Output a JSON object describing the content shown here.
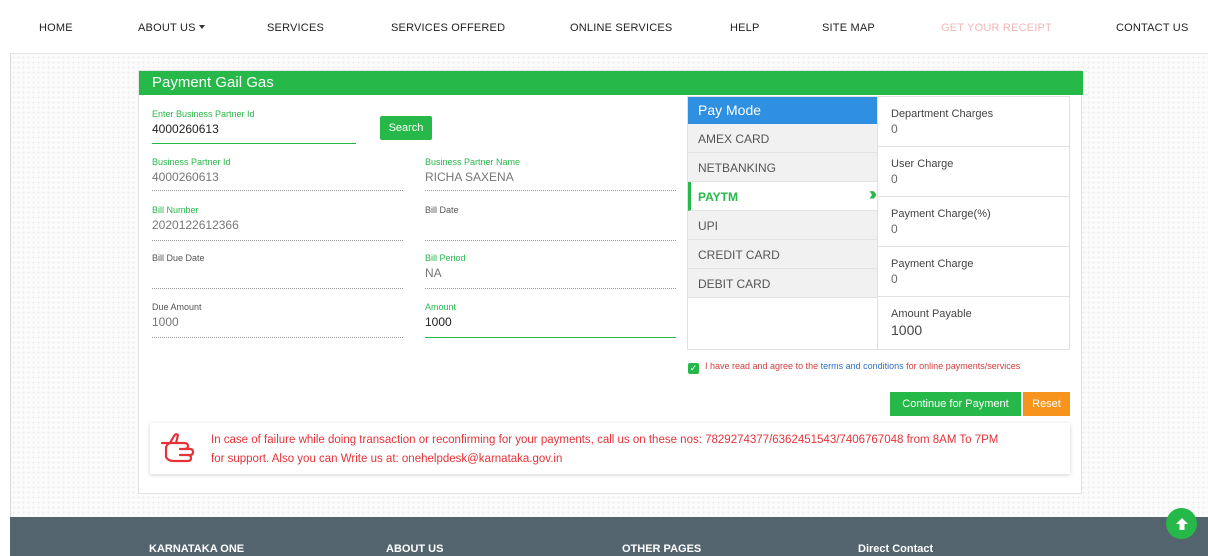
{
  "nav": {
    "home": "HOME",
    "about": "ABOUT US",
    "services": "SERVICES",
    "services_offered": "SERVICES OFFERED",
    "online_services": "ONLINE SERVICES",
    "help": "HELP",
    "site_map": "SITE MAP",
    "get_receipt": "GET YOUR RECEIPT",
    "contact": "CONTACT US"
  },
  "form": {
    "title": "Payment Gail Gas",
    "bp_id_input_label": "Enter Business Partner Id",
    "bp_id_input_value": "4000260613",
    "search_label": "Search",
    "bp_id_label": "Business Partner Id",
    "bp_id_value": "4000260613",
    "bp_name_label": "Business Partner Name",
    "bp_name_value": "RICHA SAXENA",
    "bill_number_label": "Bill Number",
    "bill_number_value": "2020122612366",
    "bill_date_label": "Bill Date",
    "bill_date_value": "",
    "bill_due_date_label": "Bill Due Date",
    "bill_due_date_value": "",
    "bill_period_label": "Bill Period",
    "bill_period_value": "NA",
    "due_amount_label": "Due Amount",
    "due_amount_value": "1000",
    "amount_label": "Amount",
    "amount_value": "1000"
  },
  "paymode": {
    "title": "Pay Mode",
    "items": [
      "AMEX CARD",
      "NETBANKING",
      "PAYTM",
      "UPI",
      "CREDIT CARD",
      "DEBIT CARD"
    ],
    "active": "PAYTM"
  },
  "charges": {
    "department_label": "Department Charges",
    "department_value": "0",
    "user_label": "User Charge",
    "user_value": "0",
    "payment_pct_label": "Payment Charge(%)",
    "payment_pct_value": "0",
    "payment_label": "Payment Charge",
    "payment_value": "0",
    "payable_label": "Amount Payable",
    "payable_value": "1000"
  },
  "agree": {
    "checked": true,
    "text_prefix": "I have read and agree to the",
    "terms_link": "terms and conditions",
    "text_suffix": "for online payments/services"
  },
  "actions": {
    "continue_label": "Continue for Payment",
    "reset_label": "Reset"
  },
  "notice": {
    "line1": "In case of failure while doing transaction or reconfirming for your payments, call us on these nos: 7829274377/6362451543/7406767048 from 8AM To 7PM",
    "line2": "for support. Also you can Write us at: onehelpdesk@karnataka.gov.in"
  },
  "footer": {
    "col1": "KARNATAKA ONE",
    "col2": "ABOUT US",
    "col3": "OTHER PAGES",
    "col4": "Direct Contact"
  },
  "colors": {
    "primary_green": "#27b84a",
    "paymode_blue": "#2f8fe0",
    "reset_orange": "#f7941d",
    "alert_red": "#e5333a",
    "footer_slate": "#53646f"
  }
}
